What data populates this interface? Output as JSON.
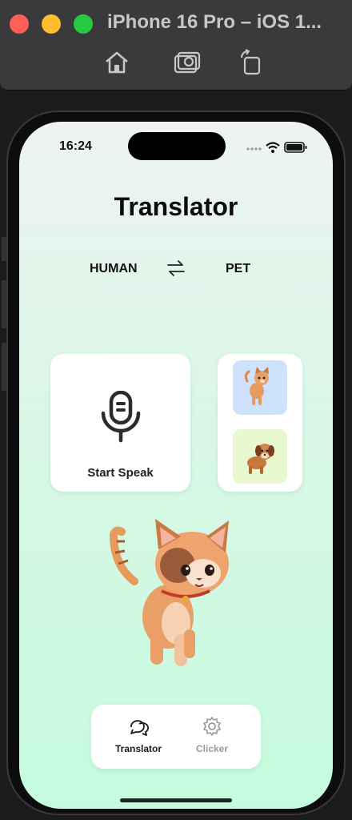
{
  "window": {
    "title": "iPhone 16 Pro – iOS 1...",
    "toolbar_icons": [
      "home-icon",
      "screenshot-icon",
      "rotate-icon"
    ]
  },
  "status_bar": {
    "time": "16:24",
    "icons": [
      "signal-dots-icon",
      "wifi-icon",
      "battery-icon"
    ]
  },
  "page": {
    "title": "Translator",
    "source_language": "HUMAN",
    "target_language": "PET",
    "swap_icon": "swap-arrows-icon"
  },
  "speak_card": {
    "icon": "microphone-icon",
    "label": "Start Speak"
  },
  "pet_selector": {
    "options": [
      {
        "name": "cat",
        "icon": "cat-icon"
      },
      {
        "name": "dog",
        "icon": "dog-icon"
      }
    ]
  },
  "tabbar": {
    "tabs": [
      {
        "label": "Translator",
        "icon": "chat-bubbles-icon",
        "active": true
      },
      {
        "label": "Clicker",
        "icon": "gear-icon",
        "active": false
      }
    ]
  },
  "colors": {
    "accent_text": "#111111",
    "inactive_tab": "#9a9a9a",
    "cat_tile": "#cfe2fb",
    "dog_tile": "#e8f8cf",
    "background_bottom": "#c5fbdd"
  }
}
